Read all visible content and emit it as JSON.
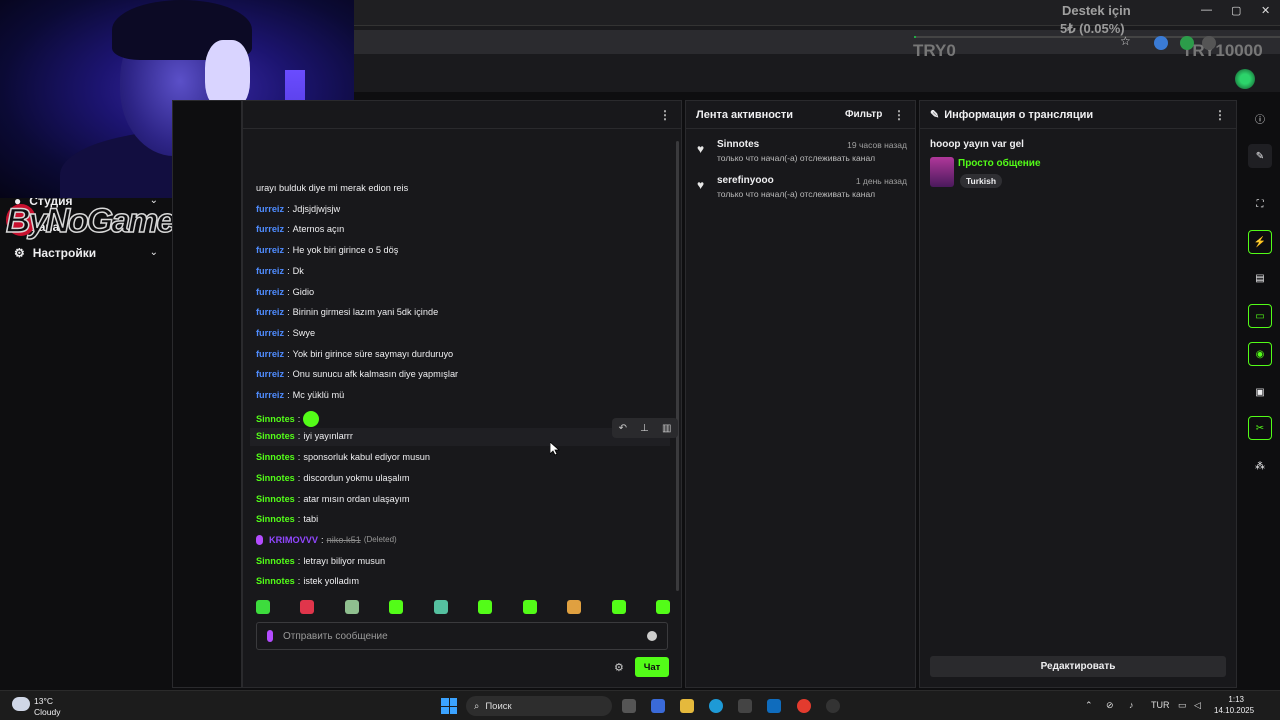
{
  "browser": {
    "goal": {
      "title": "Destek için",
      "amount": "5₺ (0.05%)",
      "start_label": "TRY0",
      "end_label": "TRY10000",
      "progress": 0.0005
    },
    "window_controls": [
      "—",
      "▢",
      "✕"
    ]
  },
  "left_nav": {
    "items": [
      {
        "label": "Студия",
        "icon": "studio-icon"
      },
      {
        "label": "Канал",
        "icon": "channel-icon"
      },
      {
        "label": "Настройки",
        "icon": "gear-icon"
      }
    ],
    "logo_text": "ByNoGame"
  },
  "chat": {
    "messages": [
      {
        "user": "",
        "text": "urayı bulduk diye mi merak edion reis",
        "color": "none"
      },
      {
        "user": "furreiz",
        "text": "Jdjsjdjwjsjw",
        "color": "blue"
      },
      {
        "user": "furreiz",
        "text": "Aternos açın",
        "color": "blue"
      },
      {
        "user": "furreiz",
        "text": "He yok biri girince o 5 döş",
        "color": "blue"
      },
      {
        "user": "furreiz",
        "text": "Dk",
        "color": "blue"
      },
      {
        "user": "furreiz",
        "text": "Gidio",
        "color": "blue"
      },
      {
        "user": "furreiz",
        "text": "Birinin girmesi lazım yani 5dk içinde",
        "color": "blue"
      },
      {
        "user": "furreiz",
        "text": "Swye",
        "color": "blue"
      },
      {
        "user": "furreiz",
        "text": "Yok biri girince süre saymayı durduruyo",
        "color": "blue"
      },
      {
        "user": "furreiz",
        "text": "Onu sunucu afk kalmasın diye yapmışlar",
        "color": "blue"
      },
      {
        "user": "furreiz",
        "text": "Mc yüklü mü",
        "color": "blue"
      },
      {
        "user": "Sinnotes",
        "text": "",
        "color": "green",
        "emote": true
      },
      {
        "user": "Sinnotes",
        "text": "iyi yayınlarrr",
        "color": "green"
      },
      {
        "user": "Sinnotes",
        "text": "sponsorluk kabul ediyor musun",
        "color": "green"
      },
      {
        "user": "Sinnotes",
        "text": "discordun yokmu ulaşalım",
        "color": "green"
      },
      {
        "user": "Sinnotes",
        "text": "atar mısın ordan ulaşayım",
        "color": "green"
      },
      {
        "user": "Sinnotes",
        "text": "tabi",
        "color": "green"
      },
      {
        "user": "KRIMOVVV",
        "text": "niko.k51",
        "color": "purple",
        "deleted": true,
        "deleted_label": "(Deleted)"
      },
      {
        "user": "Sinnotes",
        "text": "letrayı biliyor musun",
        "color": "green"
      },
      {
        "user": "Sinnotes",
        "text": "istek yolladım",
        "color": "green"
      }
    ],
    "input_placeholder": "Отправить сообщение",
    "send_label": "Чат",
    "emote_colors": [
      "#3ddc3d",
      "#e0354b",
      "#8fbf8f",
      "#53fc18",
      "#55c0a0",
      "#53fc18",
      "#53fc18",
      "#e0a040",
      "#53fc18",
      "#53fc18"
    ]
  },
  "activity": {
    "title": "Лента активности",
    "filter_label": "Фильтр",
    "items": [
      {
        "name": "Sinnotes",
        "time": "19 часов назад",
        "text": "только что начал(-а) отслеживать канал"
      },
      {
        "name": "serefinyooo",
        "time": "1 день назад",
        "text": "только что начал(-а) отслеживать канал"
      }
    ]
  },
  "stream_info": {
    "title": "Информация о трансляции",
    "stream_title": "hooop yayın var gel",
    "category": "Просто общение",
    "language_tag": "Turkish",
    "edit_label": "Редактировать"
  },
  "rail": {
    "icons": [
      "info-icon",
      "pencil-icon",
      "expand-icon",
      "bolt-icon",
      "clipboard-icon",
      "chat-icon",
      "broadcast-icon",
      "layers-icon",
      "wrench-icon",
      "share-icon"
    ]
  },
  "taskbar": {
    "weather_temp": "13°C",
    "weather_desc": "Cloudy",
    "search_label": "Поиск",
    "lang": "TUR",
    "time": "1:13",
    "date": "14.10.2025"
  },
  "colors": {
    "accent_green": "#53fc18",
    "user_blue": "#4f8cff",
    "user_purple": "#9147ff",
    "panel_bg": "#18181b",
    "page_bg": "#0e0e10"
  }
}
